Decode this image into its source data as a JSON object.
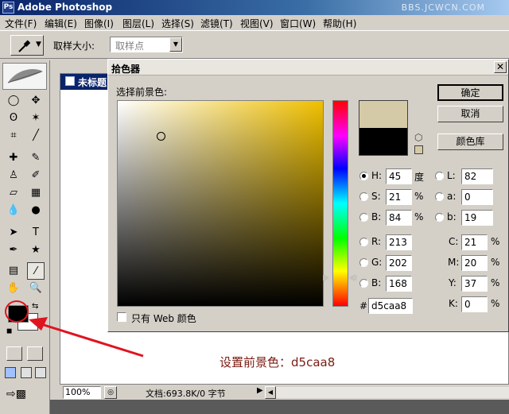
{
  "window": {
    "title": "Adobe Photoshop",
    "watermark": "BBS.JCWCN.COM"
  },
  "menu": [
    "文件(F)",
    "编辑(E)",
    "图像(I)",
    "图层(L)",
    "选择(S)",
    "滤镜(T)",
    "视图(V)",
    "窗口(W)",
    "帮助(H)"
  ],
  "options": {
    "sample_size_label": "取样大小:",
    "sample_size_value": "取样点"
  },
  "document": {
    "title": "未标题",
    "zoom": "100%",
    "status": "文档:693.8K/0 字节"
  },
  "dialog": {
    "title": "拾色器",
    "prompt": "选择前景色:",
    "buttons": {
      "ok": "确定",
      "cancel": "取消",
      "libraries": "颜色库"
    },
    "hsb": {
      "h_label": "H:",
      "h": "45",
      "h_unit": "度",
      "s_label": "S:",
      "s": "21",
      "s_unit": "%",
      "b_label": "B:",
      "b": "84",
      "b_unit": "%"
    },
    "rgb": {
      "r_label": "R:",
      "r": "213",
      "g_label": "G:",
      "g": "202",
      "b_label": "B:",
      "b": "168"
    },
    "lab": {
      "l_label": "L:",
      "l": "82",
      "a_label": "a:",
      "a": "0",
      "b_label": "b:",
      "b": "19"
    },
    "cmyk": {
      "c_label": "C:",
      "c": "21",
      "m_label": "M:",
      "m": "20",
      "y_label": "Y:",
      "y": "37",
      "k_label": "K:",
      "k": "0",
      "unit": "%"
    },
    "hex_label": "#",
    "hex": "d5caa8",
    "web_only_label": "只有 Web 颜色",
    "new_color": "#d5caa8",
    "current_color": "#000000"
  },
  "annotation": {
    "text": "设置前景色：d5caa8",
    "color": "#7a1a10"
  },
  "colors": {
    "foreground": "#000000",
    "background": "#ffffff",
    "arrow": "#e0141e"
  }
}
